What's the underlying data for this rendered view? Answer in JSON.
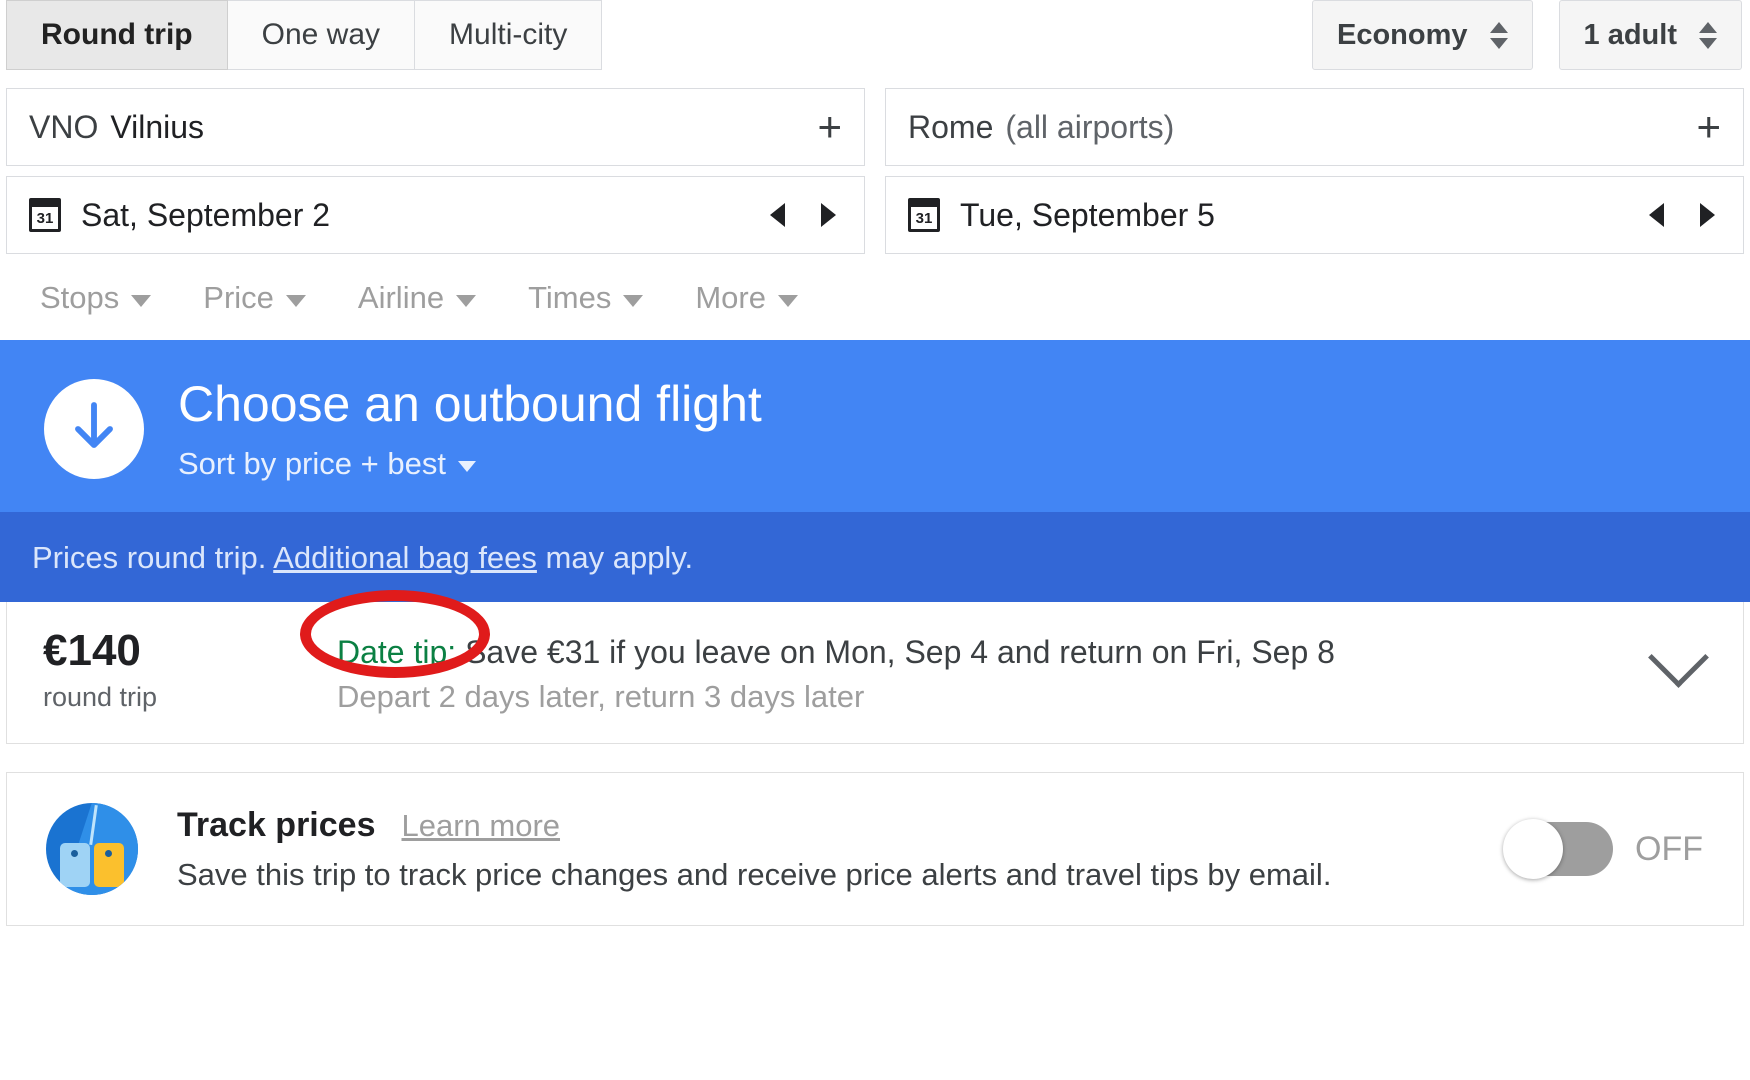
{
  "tripTabs": [
    {
      "label": "Round trip",
      "selected": true
    },
    {
      "label": "One way",
      "selected": false
    },
    {
      "label": "Multi-city",
      "selected": false
    }
  ],
  "cabin": {
    "label": "Economy",
    "icon": "spinner-icon"
  },
  "passengers": {
    "label": "1 adult",
    "icon": "spinner-icon"
  },
  "origin": {
    "code": "VNO",
    "city": "Vilnius",
    "addIcon": "plus-icon"
  },
  "destination": {
    "city": "Rome",
    "qualifier": "(all airports)",
    "addIcon": "plus-icon"
  },
  "departDate": {
    "calendarIconDay": "31",
    "value": "Sat, September 2",
    "prevIcon": "triangle-left-icon",
    "nextIcon": "triangle-right-icon"
  },
  "returnDate": {
    "calendarIconDay": "31",
    "value": "Tue, September 5",
    "prevIcon": "triangle-left-icon",
    "nextIcon": "triangle-right-icon"
  },
  "filters": [
    {
      "label": "Stops"
    },
    {
      "label": "Price"
    },
    {
      "label": "Airline"
    },
    {
      "label": "Times"
    },
    {
      "label": "More"
    }
  ],
  "hero": {
    "icon": "download-arrow-icon",
    "title": "Choose an outbound flight",
    "sort_label": "Sort by price + best",
    "background": "#4285f4"
  },
  "notice": {
    "prefix": "Prices round trip. ",
    "link": "Additional bag fees",
    "suffix": " may apply.",
    "background": "#3367d6"
  },
  "flightResult": {
    "price": "€140",
    "price_caption": "round trip",
    "tip_label": "Date tip:",
    "tip_text": " Save €31 if you leave on Mon, Sep 4 and return on Fri, Sep 8",
    "tip_subtext": "Depart 2 days later, return 3 days later",
    "expand_icon": "chevron-down-icon",
    "tip_label_color": "#0b8043",
    "annotation_color": "#e01b1b"
  },
  "trackPrices": {
    "icon": "price-tags-icon",
    "title": "Track prices",
    "learn_more": "Learn more",
    "description": "Save this trip to track price changes and receive price alerts and travel tips by email.",
    "toggle_state": "OFF",
    "toggle_label": "OFF"
  }
}
